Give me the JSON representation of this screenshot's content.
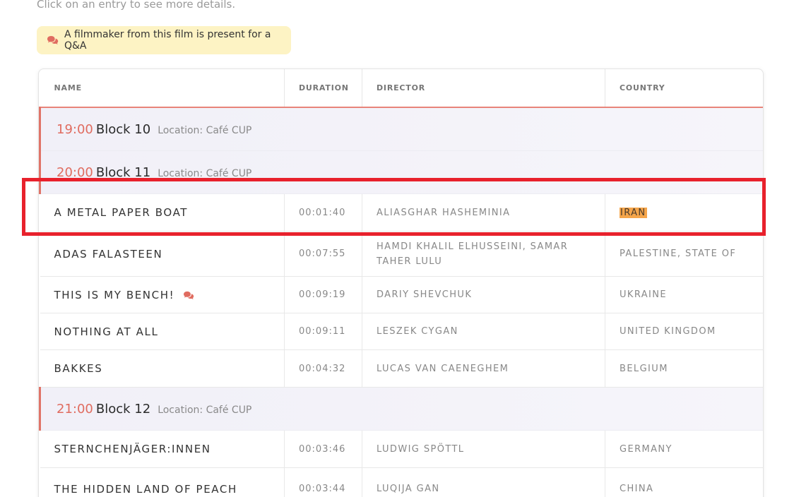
{
  "intro_text": "Click on an entry to see more details.",
  "qa_note": {
    "icon": "chat-bubbles-icon",
    "text": "A filmmaker from this film is present for a Q&A"
  },
  "headers": {
    "name": "NAME",
    "duration": "DURATION",
    "director": "DIRECTOR",
    "country": "COUNTRY"
  },
  "rows": [
    {
      "kind": "block",
      "time": "19:00",
      "name": "Block 10",
      "location": "Location: Café CUP"
    },
    {
      "kind": "block",
      "time": "20:00",
      "name": "Block 11",
      "location": "Location: Café CUP"
    },
    {
      "kind": "film",
      "name": "A METAL PAPER BOAT",
      "duration": "00:01:40",
      "director": "ALIASGHAR HASHEMINIA",
      "country": "IRAN",
      "country_highlighted": true,
      "qa": false
    },
    {
      "kind": "film",
      "name": "ADAS FALASTEEN",
      "duration": "00:07:55",
      "director": "HAMDI KHALIL ELHUSSEINI, SAMAR TAHER LULU",
      "country": "PALESTINE, STATE OF",
      "qa": false
    },
    {
      "kind": "film",
      "name": "THIS IS MY BENCH!",
      "duration": "00:09:19",
      "director": "DARIY SHEVCHUK",
      "country": "UKRAINE",
      "qa": true
    },
    {
      "kind": "film",
      "name": "NOTHING AT ALL",
      "duration": "00:09:11",
      "director": "LESZEK CYGAN",
      "country": "UNITED KINGDOM",
      "qa": false
    },
    {
      "kind": "film",
      "name": "BAKKES",
      "duration": "00:04:32",
      "director": "LUCAS VAN CAENEGHEM",
      "country": "BELGIUM",
      "qa": false
    },
    {
      "kind": "block",
      "time": "21:00",
      "name": "Block 12",
      "location": "Location: Café CUP"
    },
    {
      "kind": "film",
      "name": "STERNCHENJÄGER:INNEN",
      "duration": "00:03:46",
      "director": "LUDWIG SPÖTTL",
      "country": "GERMANY",
      "qa": false
    },
    {
      "kind": "film",
      "name": "THE HIDDEN LAND OF PEACH",
      "duration": "00:03:44",
      "director": "LUQIJA GAN",
      "country": "CHINA",
      "qa": false
    }
  ],
  "colors": {
    "accent": "#e06c60",
    "highlight_box": "#e8212c",
    "qa_note_bg": "#fdf3c4",
    "country_highlight": "#f5a54a"
  }
}
